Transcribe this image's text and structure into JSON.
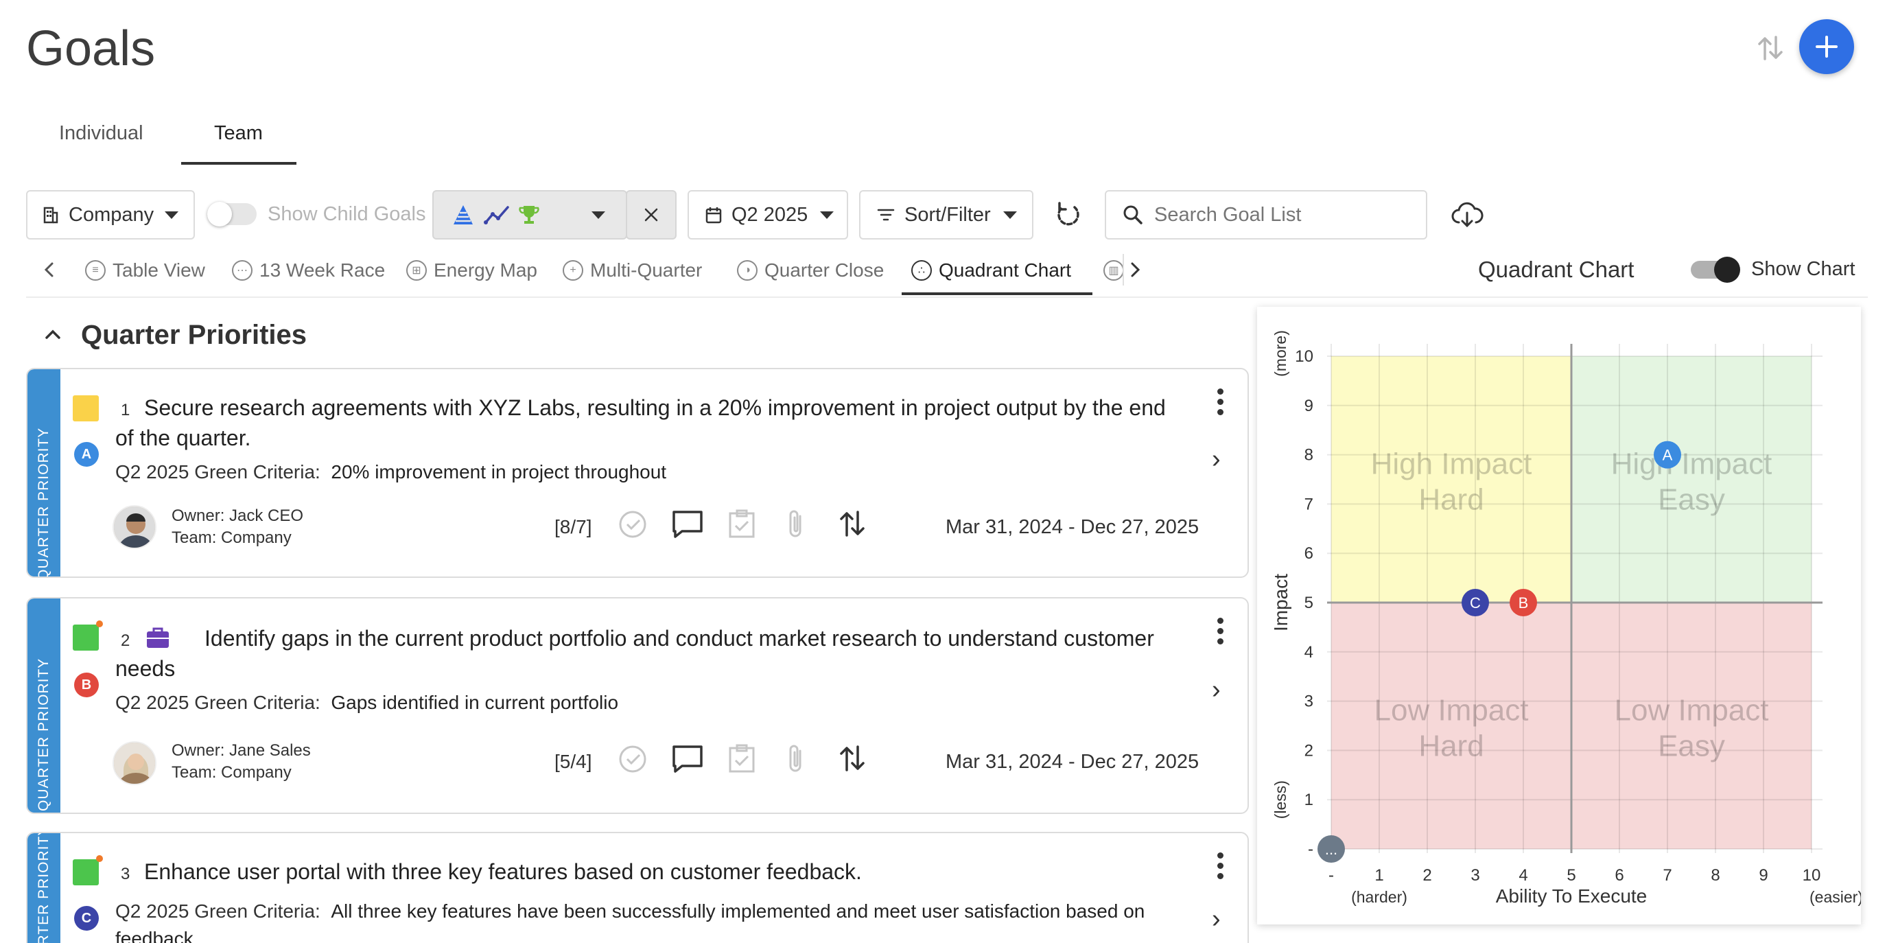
{
  "page": {
    "title": "Goals"
  },
  "tabs": [
    {
      "label": "Individual"
    },
    {
      "label": "Team"
    }
  ],
  "toolbar": {
    "company_label": "Company",
    "child_goals_label": "Show Child Goals",
    "quarter_label": "Q2 2025",
    "sort_label": "Sort/Filter",
    "search_placeholder": "Search Goal List"
  },
  "views": [
    {
      "label": "Table View"
    },
    {
      "label": "13 Week Race"
    },
    {
      "label": "Energy Map"
    },
    {
      "label": "Multi-Quarter"
    },
    {
      "label": "Quarter Close"
    },
    {
      "label": "Quadrant Chart"
    }
  ],
  "chart_header": {
    "title": "Quadrant Chart",
    "toggle_label": "Show Chart"
  },
  "section": {
    "title": "Quarter Priorities"
  },
  "goals": [
    {
      "strip": "QUARTER PRIORITY",
      "num": "1",
      "letter": "A",
      "title": "Secure research agreements with XYZ Labs, resulting in a 20% improvement in project output by the end of the quarter.",
      "criteria_label": "Q2 2025 Green Criteria:",
      "criteria": "20% improvement in project throughout",
      "owner_label": "Owner:",
      "owner": "Jack CEO",
      "team_label": "Team:",
      "team": "Company",
      "count": "[8/7]",
      "dates": "Mar 31, 2024 - Dec 27, 2025"
    },
    {
      "strip": "QUARTER PRIORITY",
      "num": "2",
      "letter": "B",
      "title": "Identify gaps in the current product portfolio and conduct market research to understand customer needs",
      "criteria_label": "Q2 2025 Green Criteria:",
      "criteria": "Gaps identified in current portfolio",
      "owner_label": "Owner:",
      "owner": "Jane Sales",
      "team_label": "Team:",
      "team": "Company",
      "count": "[5/4]",
      "dates": "Mar 31, 2024 - Dec 27, 2025"
    },
    {
      "strip": "QUARTER PRIORITY",
      "num": "3",
      "letter": "C",
      "title": "Enhance user portal with three key features based on customer feedback.",
      "criteria_label": "Q2 2025 Green Criteria:",
      "criteria": "All three key features have been successfully implemented and meet user satisfaction based on feedback."
    }
  ],
  "colors": {
    "accent": "#2f6fe4",
    "strip": "#3d8fd1",
    "goal_a": "#3b8be0",
    "goal_b": "#e1483e",
    "goal_c": "#3b44a8",
    "status_yellow": "#fad249",
    "status_green": "#4cc54c"
  },
  "chart_data": {
    "type": "scatter",
    "title": "",
    "xlabel": "Ability To Execute",
    "ylabel": "Impact",
    "x_low_label": "(harder)",
    "x_high_label": "(easier)",
    "y_low_label": "(less)",
    "y_high_label": "(more)",
    "x_ticks": [
      "-",
      "1",
      "2",
      "3",
      "4",
      "5",
      "6",
      "7",
      "8",
      "9",
      "10"
    ],
    "y_ticks": [
      "-",
      "1",
      "2",
      "3",
      "4",
      "5",
      "6",
      "7",
      "8",
      "9",
      "10"
    ],
    "xlim": [
      0,
      10
    ],
    "ylim": [
      0,
      10
    ],
    "quadrants": [
      {
        "label_1": "High Impact",
        "label_2": "Hard",
        "color": "#fdfbc6"
      },
      {
        "label_1": "High Impact",
        "label_2": "Easy",
        "color": "#e4f5e1"
      },
      {
        "label_1": "Low Impact",
        "label_2": "Hard",
        "color": "#f6d8d8"
      },
      {
        "label_1": "Low Impact",
        "label_2": "Easy",
        "color": "#f6d8d8"
      }
    ],
    "points": [
      {
        "label": "A",
        "x": 7,
        "y": 8,
        "color": "#3b8be0"
      },
      {
        "label": "C",
        "x": 3,
        "y": 5,
        "color": "#3b44a8"
      },
      {
        "label": "B",
        "x": 4,
        "y": 5,
        "color": "#e1483e"
      },
      {
        "label": "...",
        "x": 0,
        "y": 0,
        "color": "#6c7a89"
      }
    ]
  }
}
